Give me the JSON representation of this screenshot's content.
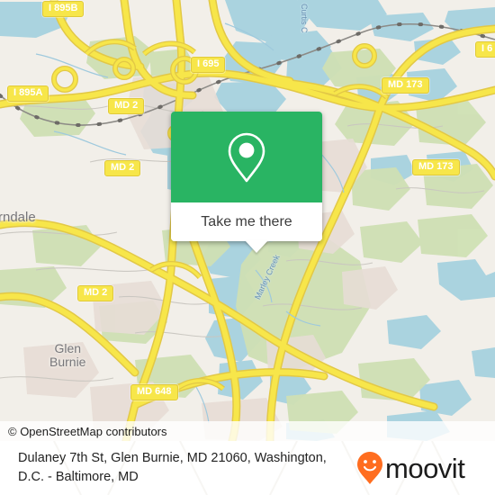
{
  "map": {
    "attribution": "© OpenStreetMap contributors",
    "places": [
      {
        "name": "Ferndale",
        "label": "rndale"
      },
      {
        "name": "Glen Burnie",
        "label": "Glen\nBurnie"
      }
    ],
    "water_labels": [
      {
        "label": "Curtis C"
      },
      {
        "label": "Marley Creek"
      }
    ],
    "shields": [
      {
        "label": "I 895B"
      },
      {
        "label": "I 695"
      },
      {
        "label": "I 895A"
      },
      {
        "label": "MD 2"
      },
      {
        "label": "MD 173"
      },
      {
        "label": "MD 2"
      },
      {
        "label": "MD 173"
      },
      {
        "label": "I 6"
      },
      {
        "label": "MD 2"
      },
      {
        "label": "MD 648"
      }
    ],
    "colors": {
      "land": "#f2efe9",
      "water": "#aad3df",
      "green_area": "#cddfaa",
      "road": "#f7e64a",
      "road_casing": "#e2c846",
      "shield_bg": "#f7e64a",
      "residential": "#e8ded8"
    }
  },
  "popup": {
    "button_label": "Take me there",
    "pin_icon": "location-pin-icon",
    "accent_color": "#29b463"
  },
  "footer": {
    "address": "Dulaney 7th St, Glen Burnie, MD 21060, Washington, D.C. - Baltimore, MD",
    "brand": "moovit",
    "brand_icon": "moovit-pin-smiley-icon",
    "brand_color": "#ff6d1f"
  }
}
